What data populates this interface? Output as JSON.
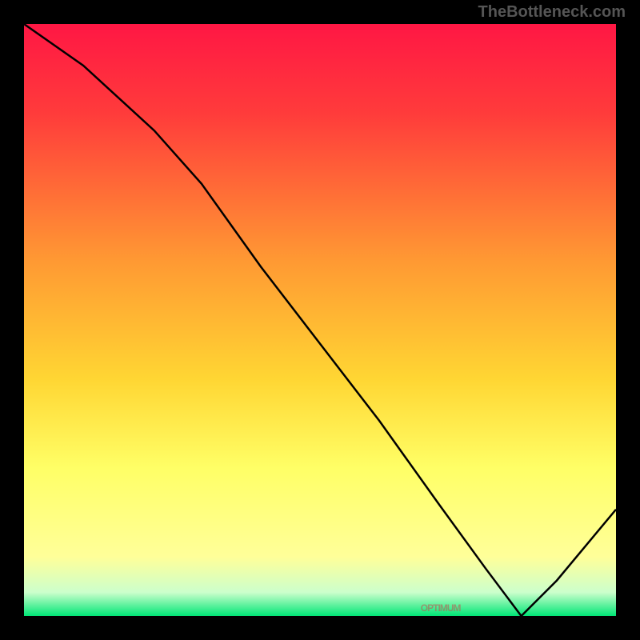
{
  "attribution": "TheBottleneck.com",
  "highlight_label": "OPTIMUM",
  "chart_data": {
    "type": "line",
    "title": "",
    "xlabel": "",
    "ylabel": "",
    "xlim": [
      0,
      100
    ],
    "ylim": [
      0,
      100
    ],
    "gradient_stops": [
      {
        "offset": 0,
        "color": "#ff1744"
      },
      {
        "offset": 15,
        "color": "#ff3b3b"
      },
      {
        "offset": 40,
        "color": "#ff9933"
      },
      {
        "offset": 60,
        "color": "#ffd633"
      },
      {
        "offset": 75,
        "color": "#ffff66"
      },
      {
        "offset": 90,
        "color": "#ffff99"
      },
      {
        "offset": 96,
        "color": "#ccffcc"
      },
      {
        "offset": 100,
        "color": "#00e676"
      }
    ],
    "series": [
      {
        "name": "curve",
        "x": [
          0,
          10,
          22,
          30,
          40,
          50,
          60,
          70,
          78,
          84,
          90,
          100
        ],
        "y": [
          100,
          93,
          82,
          73,
          59,
          46,
          33,
          19,
          8,
          0,
          6,
          18
        ]
      }
    ],
    "optimum_x_range": [
      67,
      86
    ]
  }
}
